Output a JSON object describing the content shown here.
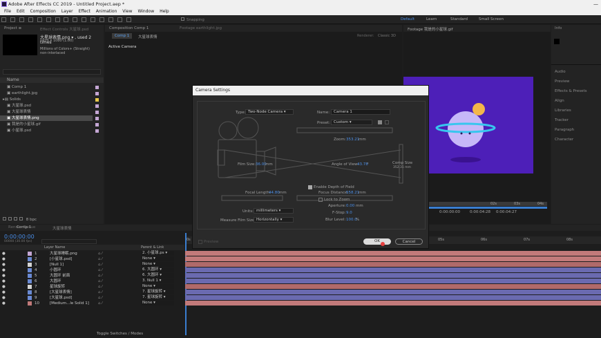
{
  "app": {
    "title": "Adobe After Effects CC 2019 - Untitled Project.aep *",
    "window_controls": "—"
  },
  "menu": [
    "File",
    "Edit",
    "Composition",
    "Layer",
    "Effect",
    "Animation",
    "View",
    "Window",
    "Help"
  ],
  "toolbar": {
    "snapping": "Snapping",
    "workspaces": [
      "Default",
      "Learn",
      "Standard",
      "Small Screen"
    ]
  },
  "project": {
    "tab": "Project ≡",
    "effect_tab": "Effect Controls 大星球.psd",
    "selected_name": "大星球表情.png ▾ , used 2 times",
    "dims": "1920 x 1080 (1.00)",
    "color": "Millions of Colors+ (Straight)",
    "interlace": "non-interlaced",
    "search_placeholder": "",
    "name_header": "Name",
    "items": [
      {
        "name": "Comp 1",
        "color": "#c4a6d4"
      },
      {
        "name": "earthlight.jpg",
        "color": "#c4a6d4"
      },
      {
        "name": "Solids",
        "color": "#e8c84a"
      },
      {
        "name": "大星球.psd",
        "color": "#c4a6d4"
      },
      {
        "name": "大星球表情",
        "color": "#c4a6d4"
      },
      {
        "name": "大星球表情.png",
        "color": "#c4a6d4"
      },
      {
        "name": "我是的小星球.gif",
        "color": "#c4a6d4"
      },
      {
        "name": "小星球.psd",
        "color": "#c4a6d4"
      }
    ],
    "footer_bpc": "8 bpc"
  },
  "composition": {
    "tab": "Composition Comp 1",
    "footage_tab": "Footage earthlight.jpg",
    "subtab_comp": "Comp 1",
    "subtab_other": "大星球表情",
    "active_camera": "Active Camera",
    "renderer": "Renderer:",
    "renderer_value": "Classic 3D"
  },
  "footage": {
    "tab": "Footage 我是的小星球.gif",
    "time_a": "0:00:00:00",
    "time_b": "0:00:04:28",
    "time_c": "0:00:04:27",
    "ruler": [
      "02s",
      "03s",
      "04s"
    ]
  },
  "right_panels": [
    "Info",
    "Audio",
    "Preview",
    "Effects & Presets",
    "Align",
    "Libraries",
    "Tracker",
    "Paragraph",
    "Character"
  ],
  "timeline": {
    "tab_render": "Render Queue",
    "tab_comp": "Comp 1",
    "tab_other": "大星球表情",
    "timecode": "0:00:00:00",
    "timecode_sub": "00000 (30.00 fps)",
    "col_layer": "Layer Name",
    "col_parent": "Parent & Link",
    "ruler": [
      "0s",
      "05s",
      "06s",
      "07s",
      "08s",
      "09s"
    ],
    "footer": "Toggle Switches / Modes",
    "layers": [
      {
        "num": "1",
        "name": "大星球睡眠.png",
        "color": "#c4a6d4",
        "parent": "2. 小星球.ps",
        "bar": "#c27a7a"
      },
      {
        "num": "2",
        "name": "[小星球.psd]",
        "color": "#6a8ad4",
        "parent": "None",
        "bar": "#c27a7a"
      },
      {
        "num": "3",
        "name": "[Null 1]",
        "color": "#d4d4d4",
        "parent": "None",
        "bar": "#b06a6a"
      },
      {
        "num": "4",
        "name": "小圆环",
        "color": "#6a8ad4",
        "parent": "6. 大圆环",
        "bar": "#6a6ab0"
      },
      {
        "num": "5",
        "name": "大圆环 前面",
        "color": "#6a8ad4",
        "parent": "6. 大圆环",
        "bar": "#6a6ab0"
      },
      {
        "num": "6",
        "name": "大圆环",
        "color": "#6a8ad4",
        "parent": "3. Null 1",
        "bar": "#6a6ab0"
      },
      {
        "num": "7",
        "name": "星球旋转",
        "color": "#d4d4d4",
        "parent": "None",
        "bar": "#b06a6a"
      },
      {
        "num": "8",
        "name": "[大星球表情]",
        "color": "#6a8ad4",
        "parent": "7. 星球旋转",
        "bar": "#6a6ab0"
      },
      {
        "num": "9",
        "name": "[大星球.psd]",
        "color": "#6a8ad4",
        "parent": "7. 星球旋转",
        "bar": "#6a6ab0"
      },
      {
        "num": "10",
        "name": "[Medium...le Solid 1]",
        "color": "#c27a7a",
        "parent": "None",
        "bar": "#c27a7a"
      }
    ]
  },
  "dialog": {
    "title": "Camera Settings",
    "type_label": "Type:",
    "type_value": "Two-Node Camera",
    "name_label": "Name:",
    "name_value": "Camera 1",
    "preset_label": "Preset:",
    "preset_value": "Custom",
    "zoom_label": "Zoom:",
    "zoom_value": "353.21",
    "zoom_unit": "mm",
    "film_label": "Film Size:",
    "film_value": "36.00",
    "film_unit": "mm",
    "aov_label": "Angle of View:",
    "aov_value": "43.78",
    "aov_unit": "°",
    "comp_size_label": "Comp Size",
    "comp_size_value": "352.31 mm",
    "focal_label": "Focal Length:",
    "focal_value": "44.80",
    "focal_unit": "mm",
    "dof_label": "Enable Depth of Field",
    "focus_label": "Focus Distance:",
    "focus_value": "558.21",
    "focus_unit": "mm",
    "lock_label": "Lock to Zoom",
    "aperture_label": "Aperture:",
    "aperture_value": "0.00",
    "aperture_unit": "mm",
    "fstop_label": "F-Stop:",
    "fstop_value": "9.0",
    "blur_label": "Blur Level:",
    "blur_value": "100.0",
    "blur_unit": "%",
    "units_label": "Units:",
    "units_value": "millimeters",
    "measure_label": "Measure Film Size:",
    "measure_value": "Horizontally",
    "preview_label": "Preview",
    "ok_label": "OK",
    "cancel_label": "Cancel"
  }
}
